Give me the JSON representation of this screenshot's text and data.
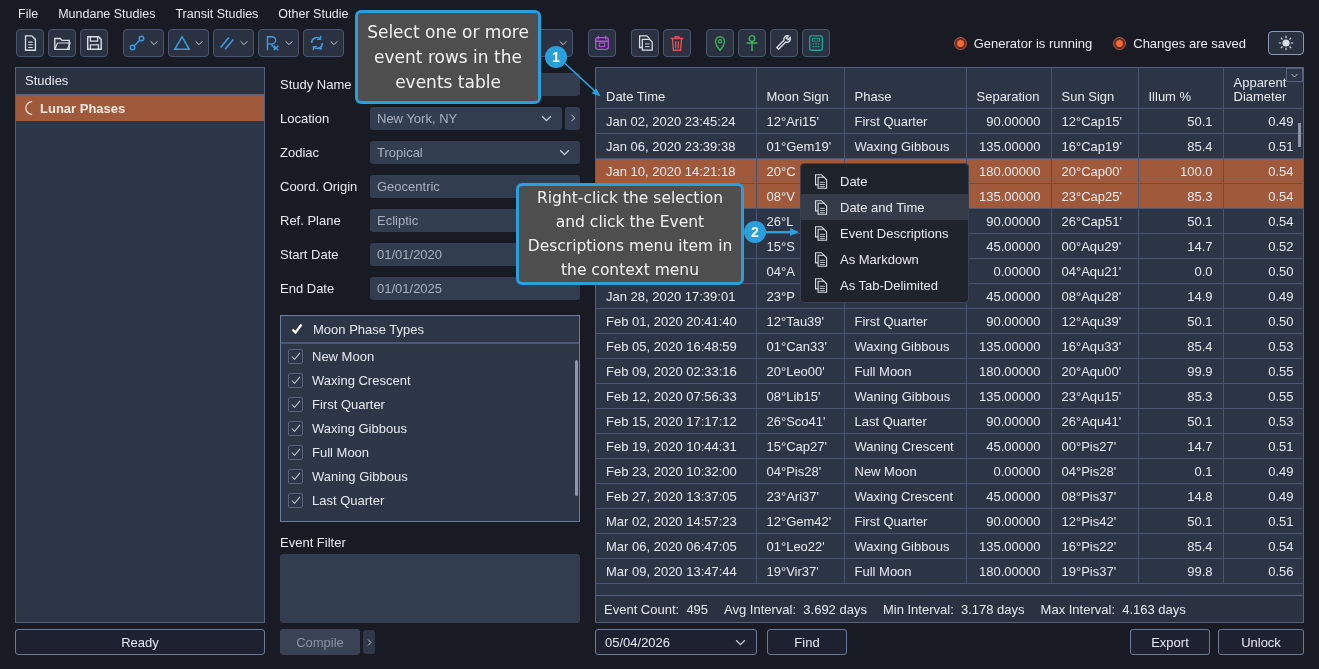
{
  "menu_bar": [
    {
      "label": "File"
    },
    {
      "label": "Mundane Studies"
    },
    {
      "label": "Transit Studies"
    },
    {
      "label": "Other Studie"
    }
  ],
  "status_indicators": [
    {
      "label": "Generator is running",
      "on": true
    },
    {
      "label": "Changes are saved",
      "on": true
    }
  ],
  "studies": {
    "title": "Studies",
    "items": [
      {
        "label": "Lunar Phases",
        "selected": true
      }
    ]
  },
  "status_button": {
    "label": "Ready"
  },
  "form": {
    "fields": [
      {
        "label": "Study Name",
        "kind": "text"
      },
      {
        "label": "Location",
        "kind": "dropdown-more",
        "value": "New York, NY"
      },
      {
        "label": "Zodiac",
        "kind": "dropdown",
        "value": "Tropical"
      },
      {
        "label": "Coord. Origin",
        "kind": "text",
        "value": "Geocentric"
      },
      {
        "label": "Ref. Plane",
        "kind": "text",
        "value": "Ecliptic"
      },
      {
        "label": "Start Date",
        "kind": "text",
        "value": "01/01/2020"
      },
      {
        "label": "End Date",
        "kind": "text",
        "value": "01/01/2025"
      }
    ]
  },
  "moon_phase_types": {
    "title": "Moon Phase Types",
    "items": [
      {
        "label": "New Moon",
        "checked": true
      },
      {
        "label": "Waxing Crescent",
        "checked": true
      },
      {
        "label": "First Quarter",
        "checked": true
      },
      {
        "label": "Waxing Gibbous",
        "checked": true
      },
      {
        "label": "Full Moon",
        "checked": true
      },
      {
        "label": "Waning Gibbous",
        "checked": true
      },
      {
        "label": "Last Quarter",
        "checked": true
      }
    ]
  },
  "event_filter": {
    "label": "Event Filter"
  },
  "compile_button": {
    "label": "Compile",
    "disabled": true
  },
  "events_table": {
    "columns": [
      "Date Time",
      "Moon Sign",
      "Phase",
      "Separation",
      "Sun Sign",
      "Illum %",
      "Apparent Diameter"
    ],
    "rows": [
      {
        "selected": false,
        "cells": [
          "Jan 02, 2020 23:45:24",
          "12°Ari15'",
          "First Quarter",
          "90.00000",
          "12°Cap15'",
          "50.1",
          "0.49"
        ]
      },
      {
        "selected": false,
        "cells": [
          "Jan 06, 2020 23:39:38",
          "01°Gem19'",
          "Waxing Gibbous",
          "135.00000",
          "16°Cap19'",
          "85.4",
          "0.51"
        ]
      },
      {
        "selected": true,
        "cells": [
          "Jan 10, 2020 14:21:18",
          "20°C",
          null,
          "180.00000",
          "20°Cap00'",
          "100.0",
          "0.54"
        ]
      },
      {
        "selected": true,
        "cells": [
          null,
          "08°V",
          null,
          "135.00000",
          "23°Cap25'",
          "85.3",
          "0.54"
        ]
      },
      {
        "selected": false,
        "cells": [
          null,
          "26°L",
          null,
          "90.00000",
          "26°Cap51'",
          "50.1",
          "0.54"
        ]
      },
      {
        "selected": false,
        "cells": [
          null,
          "15°S",
          null,
          "45.00000",
          "00°Aqu29'",
          "14.7",
          "0.52"
        ]
      },
      {
        "selected": false,
        "cells": [
          null,
          "04°A",
          null,
          "0.00000",
          "04°Aqu21'",
          "0.0",
          "0.50"
        ]
      },
      {
        "selected": false,
        "cells": [
          "Jan 28, 2020 17:39:01",
          "23°P",
          null,
          "45.00000",
          "08°Aqu28'",
          "14.9",
          "0.49"
        ]
      },
      {
        "selected": false,
        "cells": [
          "Feb 01, 2020 20:41:40",
          "12°Tau39'",
          "First Quarter",
          "90.00000",
          "12°Aqu39'",
          "50.1",
          "0.50"
        ]
      },
      {
        "selected": false,
        "cells": [
          "Feb 05, 2020 16:48:59",
          "01°Can33'",
          "Waxing Gibbous",
          "135.00000",
          "16°Aqu33'",
          "85.4",
          "0.53"
        ]
      },
      {
        "selected": false,
        "cells": [
          "Feb 09, 2020 02:33:16",
          "20°Leo00'",
          "Full Moon",
          "180.00000",
          "20°Aqu00'",
          "99.9",
          "0.55"
        ]
      },
      {
        "selected": false,
        "cells": [
          "Feb 12, 2020 07:56:33",
          "08°Lib15'",
          "Waning Gibbous",
          "135.00000",
          "23°Aqu15'",
          "85.3",
          "0.55"
        ]
      },
      {
        "selected": false,
        "cells": [
          "Feb 15, 2020 17:17:12",
          "26°Sco41'",
          "Last Quarter",
          "90.00000",
          "26°Aqu41'",
          "50.1",
          "0.53"
        ]
      },
      {
        "selected": false,
        "cells": [
          "Feb 19, 2020 10:44:31",
          "15°Cap27'",
          "Waning Crescent",
          "45.00000",
          "00°Pis27'",
          "14.7",
          "0.51"
        ]
      },
      {
        "selected": false,
        "cells": [
          "Feb 23, 2020 10:32:00",
          "04°Pis28'",
          "New Moon",
          "0.00000",
          "04°Pis28'",
          "0.1",
          "0.49"
        ]
      },
      {
        "selected": false,
        "cells": [
          "Feb 27, 2020 13:37:05",
          "23°Ari37'",
          "Waxing Crescent",
          "45.00000",
          "08°Pis37'",
          "14.8",
          "0.49"
        ]
      },
      {
        "selected": false,
        "cells": [
          "Mar 02, 2020 14:57:23",
          "12°Gem42'",
          "First Quarter",
          "90.00000",
          "12°Pis42'",
          "50.1",
          "0.51"
        ]
      },
      {
        "selected": false,
        "cells": [
          "Mar 06, 2020 06:47:05",
          "01°Leo22'",
          "Waxing Gibbous",
          "135.00000",
          "16°Pis22'",
          "85.4",
          "0.54"
        ]
      },
      {
        "selected": false,
        "cells": [
          "Mar 09, 2020 13:47:44",
          "19°Vir37'",
          "Full Moon",
          "180.00000",
          "19°Pis37'",
          "99.8",
          "0.56"
        ]
      }
    ]
  },
  "summary": [
    {
      "label": "Event Count:",
      "value": "495"
    },
    {
      "label": "Avg Interval:",
      "value": "3.692 days"
    },
    {
      "label": "Min Interval:",
      "value": "3.178 days"
    },
    {
      "label": "Max Interval:",
      "value": "4.163 days"
    }
  ],
  "date_picker": {
    "value": "05/04/2026"
  },
  "find_button": {
    "label": "Find"
  },
  "export_button": {
    "label": "Export"
  },
  "unlock_button": {
    "label": "Unlock"
  },
  "context_menu": {
    "items": [
      {
        "label": "Date",
        "selected": false
      },
      {
        "label": "Date and Time",
        "selected": true
      },
      {
        "label": "Event Descriptions",
        "selected": false
      },
      {
        "label": "As Markdown",
        "selected": false
      },
      {
        "label": "As Tab-Delimited",
        "selected": false
      }
    ]
  },
  "callouts": [
    {
      "number": "1",
      "text": "Select one or more event rows in the events table"
    },
    {
      "number": "2",
      "text": "Right-click the selection and click the Event Descriptions menu item in the context menu"
    }
  ]
}
